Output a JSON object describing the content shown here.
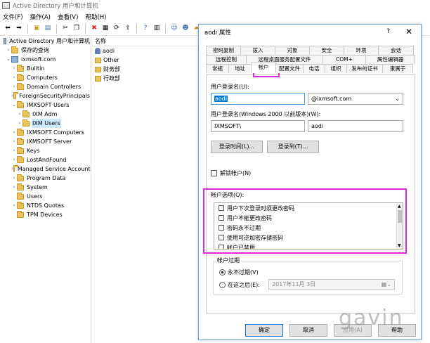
{
  "window": {
    "title": "Active Directory 用户和计算机"
  },
  "menu": [
    "文件(F)",
    "操作(A)",
    "查看(V)",
    "帮助(H)"
  ],
  "tree": {
    "root": "Active Directory 用户和计算机",
    "saved_queries": "保存的查询",
    "domain": "ixmsoft.com",
    "nodes": [
      "Builtin",
      "Computers",
      "Domain Controllers",
      "ForeignSecurityPrincipals",
      "IMXSOFT Users",
      "IXM Adm",
      "IXM Users",
      "IXMSOFT Computers",
      "IXMSOFT Server",
      "Keys",
      "LostAndFound",
      "Managed Service Accounts",
      "Program Data",
      "System",
      "Users",
      "NTDS Quotas",
      "TPM Devices"
    ]
  },
  "list": {
    "header": "名称",
    "rows": [
      "aodi",
      "Other",
      "财务部",
      "行政部"
    ]
  },
  "dialog": {
    "title": "aodi 属性",
    "help": "?",
    "close": "✕",
    "tabs_row1": [
      "密码复制",
      "拨入",
      "对象",
      "安全",
      "环境",
      "会话"
    ],
    "tabs_row2": [
      "远程控制",
      "远程桌面服务配置文件",
      "COM+",
      "属性编辑器"
    ],
    "tabs_row3": [
      "常规",
      "地址",
      "帐户",
      "配置文件",
      "电话",
      "组织",
      "发布的证书",
      "隶属于"
    ],
    "logon_name_label": "用户登录名(U):",
    "logon_name_value": "aodi",
    "upn_suffix": "@ixmsoft.com",
    "pre2000_label": "用户登录名(Windows 2000 以前版本)(W):",
    "pre2000_domain": "IXMSOFT\\",
    "pre2000_name": "aodi",
    "logon_hours_btn": "登录时间(L)...",
    "logon_to_btn": "登录到(T)...",
    "unlock_label": "解锁帐户(N)",
    "options_label": "帐户选项(O):",
    "options": [
      "用户下次登录时须更改密码",
      "用户不能更改密码",
      "密码永不过期",
      "使用可逆加密存储密码",
      "帐户已禁用"
    ],
    "expiry_label": "帐户过期",
    "never_expires": "永不过期(V)",
    "end_of": "在这之后(E):",
    "expiry_date": "2017年11月 3日",
    "ok": "确定",
    "cancel": "取消",
    "apply": "应用(A)",
    "help_btn": "帮助"
  },
  "watermark": "gavin",
  "colors": {
    "highlight": "#e028e0",
    "selection": "#0078d7"
  }
}
